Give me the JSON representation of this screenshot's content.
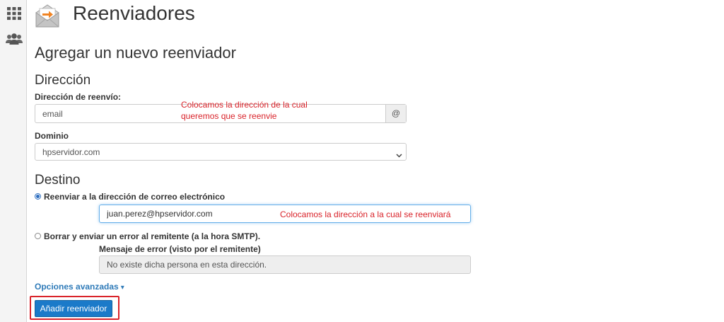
{
  "sidebar": {
    "icons": [
      "grid-icon",
      "users-icon"
    ]
  },
  "header": {
    "title": "Reenviadores",
    "icon": "email-forward-icon"
  },
  "form": {
    "heading": "Agregar un nuevo reenviador",
    "address_section": {
      "heading": "Dirección",
      "forward_label": "Dirección de reenvío:",
      "forward_value": "email",
      "at_symbol": "@",
      "domain_label": "Dominio",
      "domain_value": "hpservidor.com"
    },
    "destination_section": {
      "heading": "Destino",
      "option_forward_label": "Reenviar a la dirección de correo electrónico",
      "destination_value": "juan.perez@hpservidor.com",
      "option_discard_label": "Borrar y enviar un error al remitente (a la hora SMTP).",
      "error_message_label": "Mensaje de error (visto por el remitente)",
      "error_message_value": "No existe dicha persona en esta dirección."
    },
    "advanced_options_label": "Opciones avanzadas",
    "submit_label": "Añadir reenviador"
  },
  "annotations": {
    "forward_note_line1": "Colocamos la dirección de la cual",
    "forward_note_line2": "queremos que se reenvie",
    "destination_note": "Colocamos la dirección a la cual se reenviará"
  },
  "colors": {
    "primary_button": "#1b7ac9",
    "link": "#2e7ab8",
    "annotation": "#d9232a",
    "focus_border": "#66afe9"
  }
}
